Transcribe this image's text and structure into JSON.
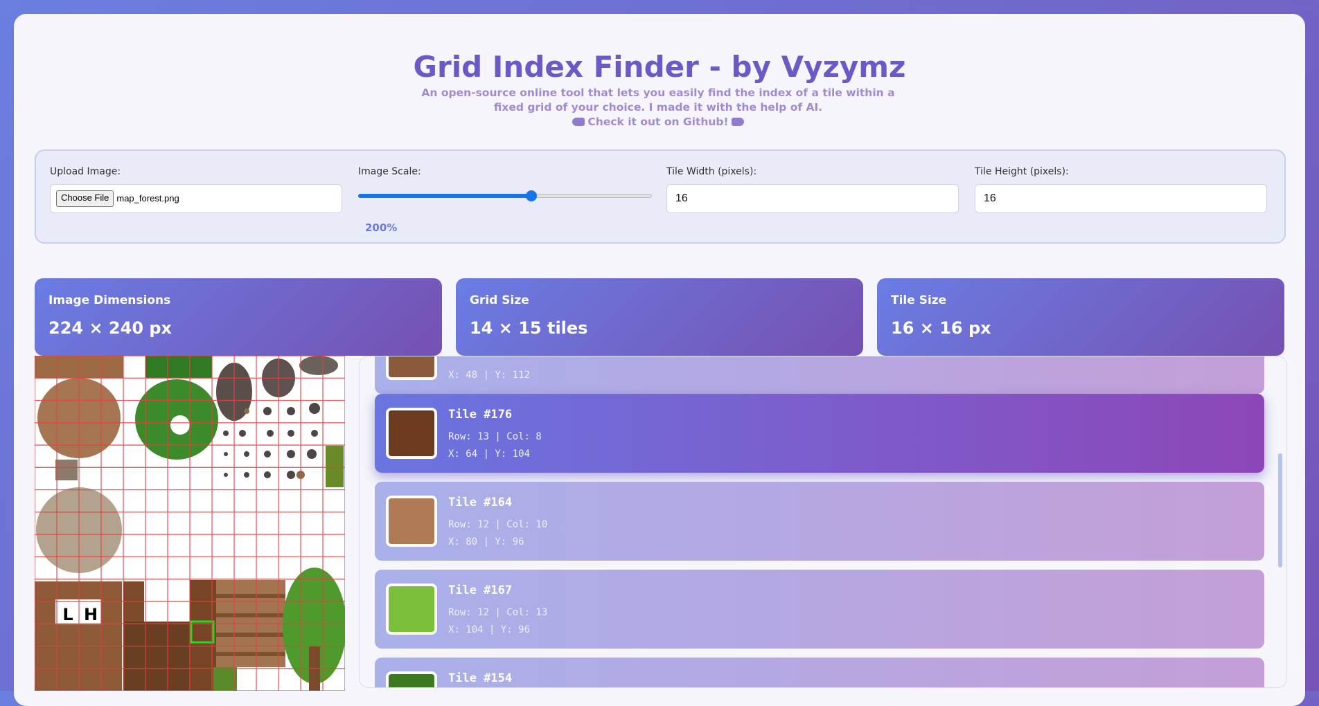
{
  "header": {
    "title": "Grid Index Finder - by Vyzymz",
    "subtitle": "An open-source online tool that lets you easily find the index of a tile within a fixed grid of your choice. I made it with the help of AI.",
    "github_link": "Check it out on Github!"
  },
  "controls": {
    "upload_label": "Upload Image:",
    "choose_file_label": "Choose File",
    "file_name": "map_forest.png",
    "scale_label": "Image Scale:",
    "scale_value": "200%",
    "scale_fraction": 0.59,
    "tile_width_label": "Tile Width (pixels):",
    "tile_width_value": "16",
    "tile_height_label": "Tile Height (pixels):",
    "tile_height_value": "16"
  },
  "stats": {
    "image_dimensions_label": "Image Dimensions",
    "image_dimensions_value": "224 × 240 px",
    "grid_size_label": "Grid Size",
    "grid_size_value": "14 × 15 tiles",
    "tile_size_label": "Tile Size",
    "tile_size_value": "16 × 16 px"
  },
  "tiles": [
    {
      "name": "",
      "rowcol": "",
      "xy": "X: 48 | Y: 112",
      "color": "#8b5a3c"
    },
    {
      "name": "Tile #176",
      "rowcol": "Row: 13 | Col: 8",
      "xy": "X: 64 | Y: 104",
      "color": "#6b3a1f"
    },
    {
      "name": "Tile #164",
      "rowcol": "Row: 12 | Col: 10",
      "xy": "X: 80 | Y: 96",
      "color": "#b07a55"
    },
    {
      "name": "Tile #167",
      "rowcol": "Row: 12 | Col: 13",
      "xy": "X: 104 | Y: 96",
      "color": "#7cbf3a"
    },
    {
      "name": "Tile #154",
      "rowcol": "",
      "xy": "",
      "color": "#3c7a22"
    }
  ],
  "colors": {
    "accent": "#6a5ac6",
    "grid_line": "#e84040",
    "highlight": "#22dd22"
  }
}
